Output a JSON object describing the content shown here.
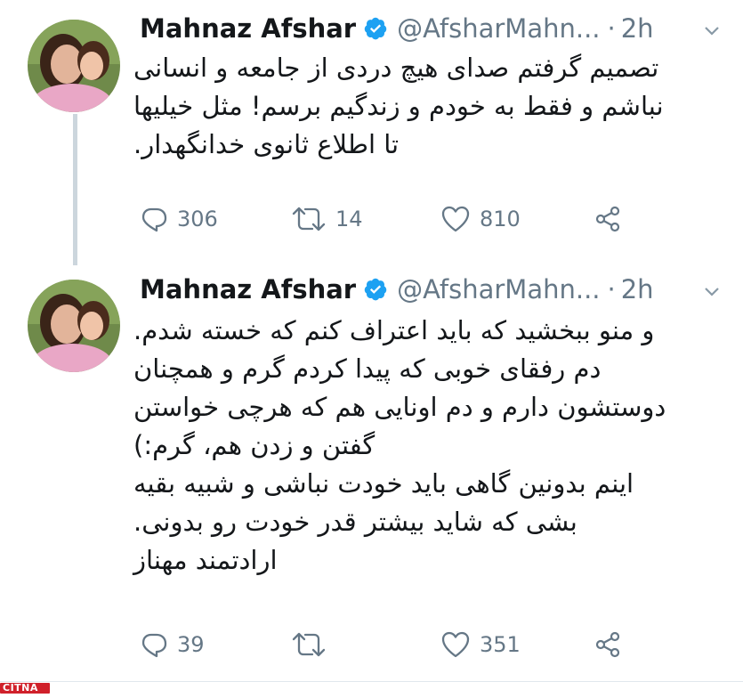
{
  "tweets": [
    {
      "author_name": "Mahnaz Afshar",
      "handle": "@AfsharMahn...",
      "separator": "·",
      "time": "2h",
      "text": "تصمیم گرفتم صدای هیچ دردی از جامعه و انسانی\nنباشم و فقط به خودم و زندگیم برسم! مثل خیلیها\nتا اطلاع ثانوی خدانگهدار.",
      "replies": "306",
      "retweets": "14",
      "likes": "810"
    },
    {
      "author_name": "Mahnaz Afshar",
      "handle": "@AfsharMahn...",
      "separator": "·",
      "time": "2h",
      "text": "و منو ببخشید که باید اعتراف کنم که خسته شدم.\nدم رفقای خوبی که پیدا کردم گرم و همچنان\nدوستشون دارم و دم اونایی هم که هرچی خواستن\nگفتن و زدن هم، گرم:)\nاینم بدونین گاهی باید خودت نباشی و شبیه بقیه\nبشی که شاید بیشتر قدر خودت رو بدونی.\nارادتمند مهناز",
      "replies": "39",
      "retweets": "",
      "likes": "351"
    }
  ],
  "icons": {
    "verified": "verified-badge-icon",
    "caret": "chevron-down-icon",
    "reply": "reply-icon",
    "retweet": "retweet-icon",
    "like": "heart-icon",
    "share": "share-icon"
  },
  "colors": {
    "text": "#14171a",
    "secondary": "#657786",
    "verified": "#1da1f2",
    "thread_line": "#ccd6dd",
    "watermark": "#d0202a"
  },
  "watermark": "CITNA"
}
